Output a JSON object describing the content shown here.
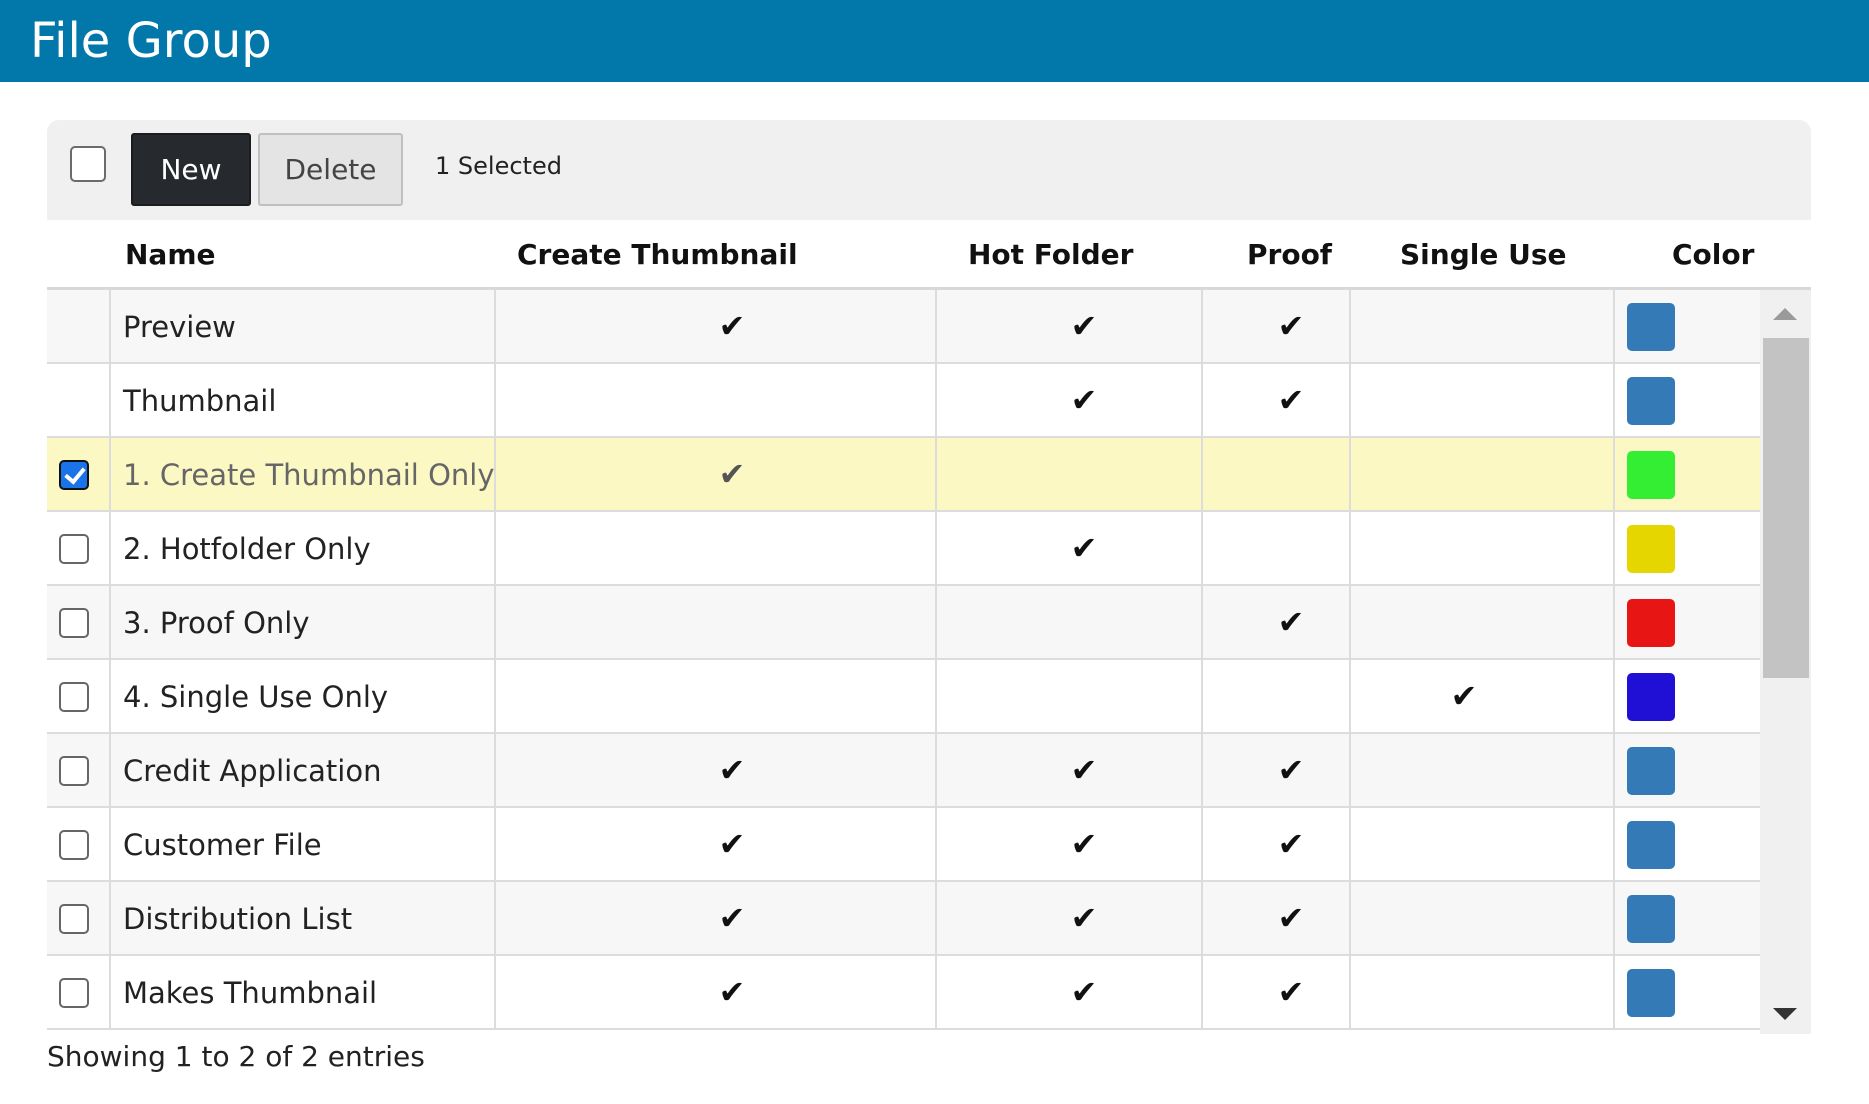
{
  "header": {
    "title": "File Group"
  },
  "toolbar": {
    "new_label": "New",
    "delete_label": "Delete",
    "selected_text": "1 Selected"
  },
  "columns": {
    "name": "Name",
    "create_thumbnail": "Create Thumbnail",
    "hot_folder": "Hot Folder",
    "proof": "Proof",
    "single_use": "Single Use",
    "color": "Color"
  },
  "rows": [
    {
      "name": "Preview",
      "checkbox": false,
      "checked": false,
      "create_thumbnail": true,
      "hot_folder": true,
      "proof": true,
      "single_use": false,
      "color": "#337ab7",
      "selected": false
    },
    {
      "name": "Thumbnail",
      "checkbox": false,
      "checked": false,
      "create_thumbnail": false,
      "hot_folder": true,
      "proof": true,
      "single_use": false,
      "color": "#337ab7",
      "selected": false
    },
    {
      "name": "1. Create Thumbnail Only",
      "checkbox": true,
      "checked": true,
      "create_thumbnail": true,
      "hot_folder": false,
      "proof": false,
      "single_use": false,
      "color": "#33ee33",
      "selected": true
    },
    {
      "name": "2. Hotfolder Only",
      "checkbox": true,
      "checked": false,
      "create_thumbnail": false,
      "hot_folder": true,
      "proof": false,
      "single_use": false,
      "color": "#e6d600",
      "selected": false
    },
    {
      "name": "3. Proof Only",
      "checkbox": true,
      "checked": false,
      "create_thumbnail": false,
      "hot_folder": false,
      "proof": true,
      "single_use": false,
      "color": "#e81515",
      "selected": false
    },
    {
      "name": "4. Single Use Only",
      "checkbox": true,
      "checked": false,
      "create_thumbnail": false,
      "hot_folder": false,
      "proof": false,
      "single_use": true,
      "color": "#2010d6",
      "selected": false
    },
    {
      "name": "Credit Application",
      "checkbox": true,
      "checked": false,
      "create_thumbnail": true,
      "hot_folder": true,
      "proof": true,
      "single_use": false,
      "color": "#337ab7",
      "selected": false
    },
    {
      "name": "Customer File",
      "checkbox": true,
      "checked": false,
      "create_thumbnail": true,
      "hot_folder": true,
      "proof": true,
      "single_use": false,
      "color": "#337ab7",
      "selected": false
    },
    {
      "name": "Distribution List",
      "checkbox": true,
      "checked": false,
      "create_thumbnail": true,
      "hot_folder": true,
      "proof": true,
      "single_use": false,
      "color": "#337ab7",
      "selected": false
    },
    {
      "name": "Makes Thumbnail",
      "checkbox": true,
      "checked": false,
      "create_thumbnail": true,
      "hot_folder": true,
      "proof": true,
      "single_use": false,
      "color": "#337ab7",
      "selected": false
    }
  ],
  "footer": {
    "entries_text": "Showing 1 to 2 of 2 entries"
  },
  "icons": {
    "check_mark": "✔",
    "scroll_up": "triangle-up",
    "scroll_down": "triangle-down"
  }
}
